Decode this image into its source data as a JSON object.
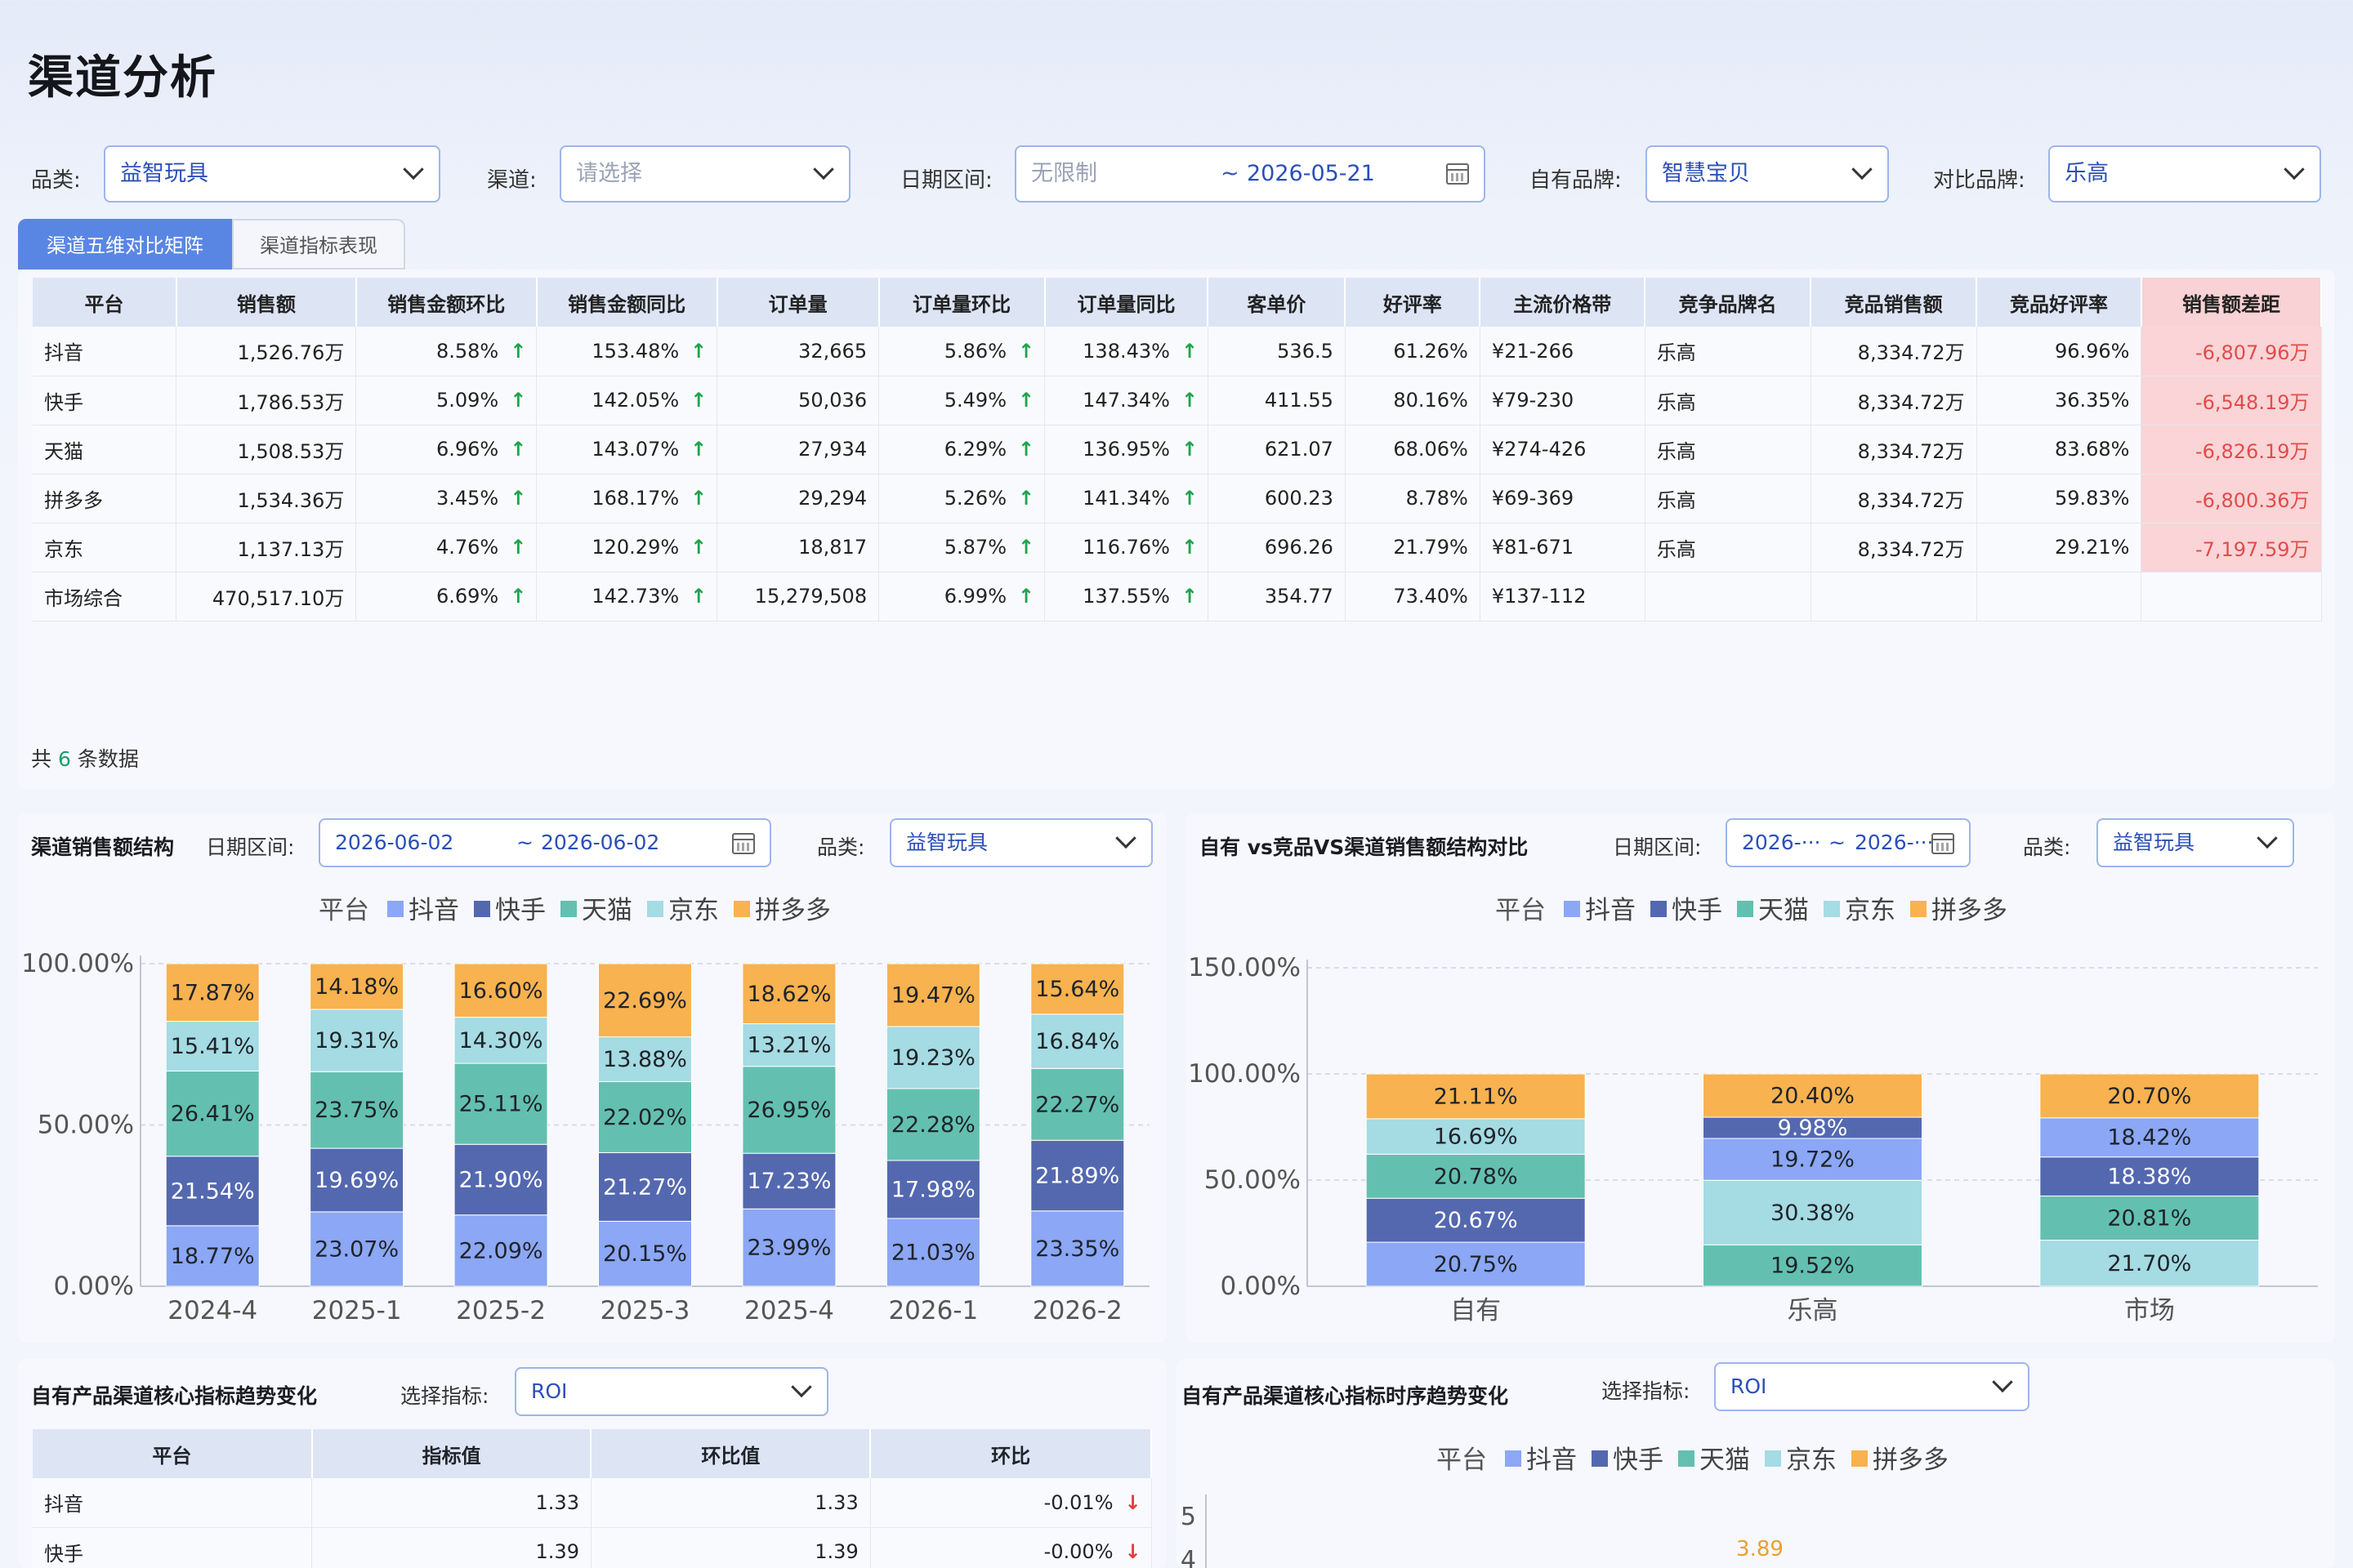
{
  "page": {
    "title": "渠道分析"
  },
  "filters": {
    "category_label": "品类:",
    "category_value": "益智玩具",
    "channel_label": "渠道:",
    "channel_placeholder": "请选择",
    "date_label": "日期区间:",
    "date_start_placeholder": "无限制",
    "date_sep": "~",
    "date_end": "2026-05-21",
    "own_brand_label": "自有品牌:",
    "own_brand_value": "智慧宝贝",
    "compare_brand_label": "对比品牌:",
    "compare_brand_value": "乐高"
  },
  "tabs": [
    {
      "label": "渠道五维对比矩阵",
      "active": true
    },
    {
      "label": "渠道指标表现",
      "active": false
    }
  ],
  "matrix": {
    "headers": [
      "平台",
      "销售额",
      "销售金额环比",
      "销售金额同比",
      "订单量",
      "订单量环比",
      "订单量同比",
      "客单价",
      "好评率",
      "主流价格带",
      "竞争品牌名",
      "竞品销售额",
      "竞品好评率",
      "销售额差距"
    ],
    "rows": [
      [
        "抖音",
        "1,526.76万",
        "8.58%",
        "153.48%",
        "32,665",
        "5.86%",
        "138.43%",
        "536.5",
        "61.26%",
        "¥21-266",
        "乐高",
        "8,334.72万",
        "96.96%",
        "-6,807.96万"
      ],
      [
        "快手",
        "1,786.53万",
        "5.09%",
        "142.05%",
        "50,036",
        "5.49%",
        "147.34%",
        "411.55",
        "80.16%",
        "¥79-230",
        "乐高",
        "8,334.72万",
        "36.35%",
        "-6,548.19万"
      ],
      [
        "天猫",
        "1,508.53万",
        "6.96%",
        "143.07%",
        "27,934",
        "6.29%",
        "136.95%",
        "621.07",
        "68.06%",
        "¥274-426",
        "乐高",
        "8,334.72万",
        "83.68%",
        "-6,826.19万"
      ],
      [
        "拼多多",
        "1,534.36万",
        "3.45%",
        "168.17%",
        "29,294",
        "5.26%",
        "141.34%",
        "600.23",
        "8.78%",
        "¥69-369",
        "乐高",
        "8,334.72万",
        "59.83%",
        "-6,800.36万"
      ],
      [
        "京东",
        "1,137.13万",
        "4.76%",
        "120.29%",
        "18,817",
        "5.87%",
        "116.76%",
        "696.26",
        "21.79%",
        "¥81-671",
        "乐高",
        "8,334.72万",
        "29.21%",
        "-7,197.59万"
      ],
      [
        "市场综合",
        "470,517.10万",
        "6.69%",
        "142.73%",
        "15,279,508",
        "6.99%",
        "137.55%",
        "354.77",
        "73.40%",
        "¥137-112",
        "",
        "",
        "",
        ""
      ]
    ],
    "footer_prefix": "共",
    "footer_count": "6",
    "footer_suffix": "条数据"
  },
  "panel1": {
    "title": "渠道销售额结构",
    "date_label": "日期区间:",
    "date_start": "2026-06-02",
    "date_sep": "~",
    "date_end": "2026-06-02",
    "category_label": "品类:",
    "category_value": "益智玩具"
  },
  "panel2": {
    "title": "自有 vs竞品VS渠道销售额结构对比",
    "date_label": "日期区间:",
    "date_start": "2026-···",
    "date_sep": "~",
    "date_end": "2026-···",
    "category_label": "品类:",
    "category_value": "益智玩具"
  },
  "panel3": {
    "title": "自有产品渠道核心指标趋势变化",
    "metric_label": "选择指标:",
    "metric_value": "ROI",
    "headers": [
      "平台",
      "指标值",
      "环比值",
      "环比"
    ],
    "rows": [
      [
        "抖音",
        "1.33",
        "1.33",
        "-0.01%"
      ],
      [
        "快手",
        "1.39",
        "1.39",
        "-0.00%"
      ]
    ]
  },
  "panel4": {
    "title": "自有产品渠道核心指标时序趋势变化",
    "metric_label": "选择指标:",
    "metric_value": "ROI"
  },
  "colors": {
    "抖音": "#8ba7f5",
    "快手": "#5468b0",
    "天猫": "#63c0b0",
    "京东": "#a5dbe3",
    "拼多多": "#f8b24f",
    "accent": "#5a86e3",
    "up": "#1ea44b",
    "down": "#e23c3c"
  },
  "chart_data": [
    {
      "type": "bar",
      "stacked": true,
      "legend_title": "平台",
      "legend_position": "top",
      "categories": [
        "2024-4",
        "2025-1",
        "2025-2",
        "2025-3",
        "2025-4",
        "2026-1",
        "2026-2"
      ],
      "series": [
        {
          "name": "抖音",
          "values": [
            18.77,
            23.07,
            22.09,
            20.15,
            23.99,
            21.03,
            23.35
          ]
        },
        {
          "name": "快手",
          "values": [
            21.54,
            19.69,
            21.9,
            21.27,
            17.23,
            17.98,
            21.89
          ]
        },
        {
          "name": "天猫",
          "values": [
            26.41,
            23.75,
            25.11,
            22.02,
            26.95,
            22.28,
            22.27
          ]
        },
        {
          "name": "京东",
          "values": [
            15.41,
            19.31,
            14.3,
            13.88,
            13.21,
            19.23,
            16.84
          ]
        },
        {
          "name": "拼多多",
          "values": [
            17.87,
            14.18,
            16.6,
            22.69,
            18.62,
            19.47,
            15.64
          ]
        }
      ],
      "ylim": [
        0,
        100
      ],
      "yticks": [
        "0.00%",
        "50.00%",
        "100.00%"
      ]
    },
    {
      "type": "bar",
      "stacked": true,
      "legend_title": "平台",
      "legend_position": "top",
      "categories": [
        "自有",
        "乐高",
        "市场"
      ],
      "stacks": [
        [
          {
            "name": "抖音",
            "value": 20.75
          },
          {
            "name": "快手",
            "value": 20.67
          },
          {
            "name": "天猫",
            "value": 20.78
          },
          {
            "name": "京东",
            "value": 16.69
          },
          {
            "name": "拼多多",
            "value": 21.11
          }
        ],
        [
          {
            "name": "天猫",
            "value": 19.52
          },
          {
            "name": "京东",
            "value": 30.38
          },
          {
            "name": "抖音",
            "value": 19.72
          },
          {
            "name": "快手",
            "value": 9.98
          },
          {
            "name": "拼多多",
            "value": 20.4
          }
        ],
        [
          {
            "name": "京东",
            "value": 21.7
          },
          {
            "name": "天猫",
            "value": 20.81
          },
          {
            "name": "快手",
            "value": 18.38
          },
          {
            "name": "抖音",
            "value": 18.42
          },
          {
            "name": "拼多多",
            "value": 20.7
          }
        ]
      ],
      "ylim": [
        0,
        150
      ],
      "yticks": [
        "0.00%",
        "50.00%",
        "100.00%",
        "150.00%"
      ]
    },
    {
      "type": "line",
      "legend_title": "平台",
      "legend_position": "top",
      "series_names": [
        "抖音",
        "快手",
        "天猫",
        "京东",
        "拼多多"
      ],
      "yticks": [
        "4",
        "5"
      ],
      "data_labels": [
        "3.89"
      ]
    }
  ]
}
